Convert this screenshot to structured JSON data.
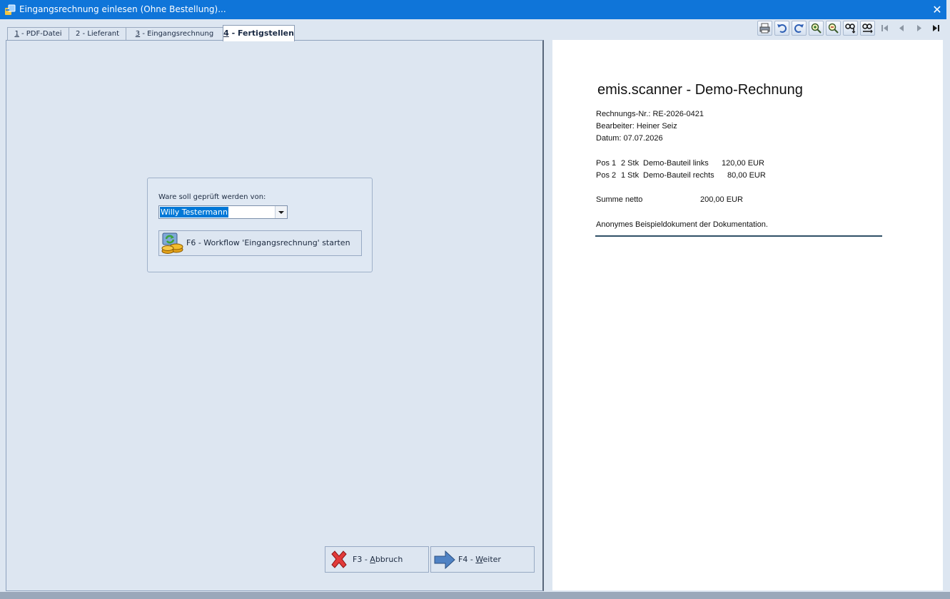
{
  "window": {
    "title": "Eingangsrechnung einlesen (Ohne Bestellung)...",
    "close_glyph": "✕",
    "app_icon": "app-icon"
  },
  "tabs": [
    {
      "key": "1",
      "rest": " - PDF-Datei"
    },
    {
      "key": "2",
      "rest": " - Lieferant"
    },
    {
      "key": "3",
      "rest": " - Eingangsrechnung"
    },
    {
      "key": "4",
      "rest": " - Fertigstellen",
      "active": true
    }
  ],
  "toolbar": {
    "icons": [
      "print-icon",
      "rotate-left-icon",
      "rotate-right-icon",
      "zoom-in-icon",
      "zoom-out-icon",
      "fit-width-icon",
      "fit-page-icon",
      "first-page-icon",
      "previous-page-icon",
      "next-page-icon",
      "last-page-icon"
    ]
  },
  "checker": {
    "label": "Ware soll geprüft werden von:",
    "selected": "Willy Testermann"
  },
  "workflow_button": {
    "label": "F6 - Workflow 'Eingangsrechnung' starten",
    "icon": "workflow-coins-icon"
  },
  "buttons": {
    "cancel": {
      "prefix": "F3 - ",
      "underlined": "A",
      "rest": "bbruch",
      "icon": "cancel-x-icon"
    },
    "next": {
      "prefix": "F4 - ",
      "underlined": "W",
      "rest": "eiter",
      "icon": "arrow-right-icon"
    }
  },
  "preview": {
    "title": "emis.scanner - Demo-Rechnung",
    "invoice_no": "Rechnungs-Nr.: RE-2026-0421",
    "editor": "Bearbeiter: Heiner Seiz",
    "date": "Datum: 07.07.2026",
    "positions": [
      {
        "pos": "Pos 1",
        "qty": "2 Stk",
        "desc": "Demo-Bauteil links",
        "amount": "120,00 EUR"
      },
      {
        "pos": "Pos 2",
        "qty": "1 Stk",
        "desc": "Demo-Bauteil rechts",
        "amount": "80,00 EUR"
      }
    ],
    "sum_label": "Summe netto",
    "sum_value": "200,00 EUR",
    "note": "Anonymes Beispieldokument der Dokumentation."
  },
  "colors": {
    "titlebar": "#0f75d9",
    "panel_bg": "#dde6f1",
    "selection": "#0078d7"
  }
}
